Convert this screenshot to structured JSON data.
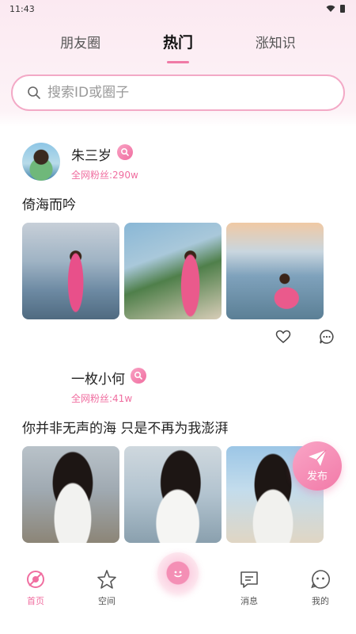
{
  "status_bar": {
    "time": "11:43"
  },
  "top_tabs": [
    {
      "label": "朋友圈",
      "active": false
    },
    {
      "label": "热门",
      "active": true
    },
    {
      "label": "涨知识",
      "active": false
    }
  ],
  "search": {
    "placeholder": "搜索ID或圈子"
  },
  "posts": [
    {
      "user_name": "朱三岁",
      "fans": "全网粉丝:290w",
      "caption": "倚海而吟"
    },
    {
      "user_name": "一枚小何",
      "fans": "全网粉丝:41w",
      "caption": "你并非无声的海 只是不再为我澎湃"
    }
  ],
  "fab": {
    "label": "发布"
  },
  "bottom_nav": [
    {
      "label": "首页",
      "icon": "home-icon",
      "active": true
    },
    {
      "label": "空间",
      "icon": "star-icon",
      "active": false
    },
    {
      "label": "",
      "icon": "center-face-icon",
      "active": false
    },
    {
      "label": "消息",
      "icon": "message-icon",
      "active": false
    },
    {
      "label": "我的",
      "icon": "profile-face-icon",
      "active": false
    }
  ],
  "colors": {
    "accent": "#f06ea0",
    "search_border": "#f3a9c6"
  }
}
